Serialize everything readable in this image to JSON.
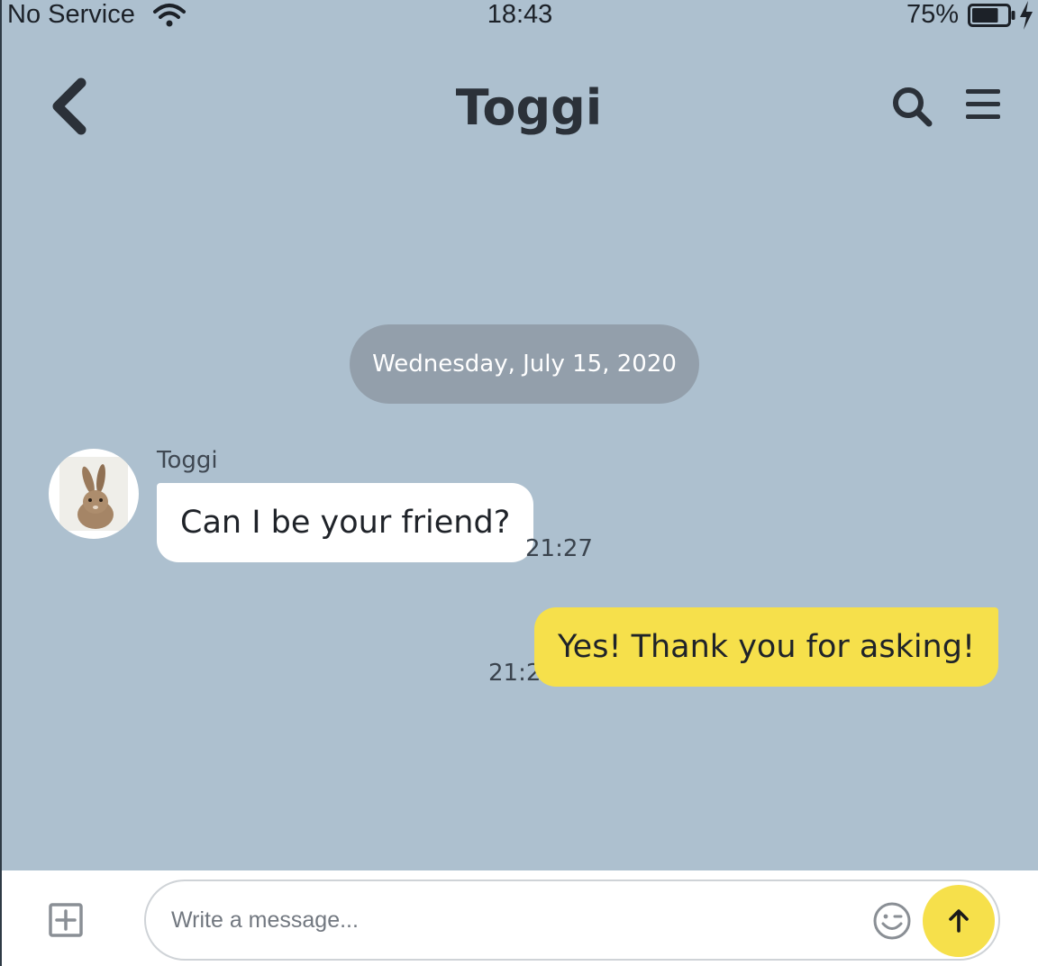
{
  "status_bar": {
    "carrier": "No Service",
    "time": "18:43",
    "battery": "75%",
    "battery_level": 0.75
  },
  "header": {
    "title": "Toggi",
    "icons": [
      "chevron-left-icon",
      "search-icon",
      "menu-icon"
    ]
  },
  "chat": {
    "date_label": "Wednesday, July 15, 2020",
    "messages": [
      {
        "direction": "incoming",
        "sender": "Toggi",
        "text": "Can I be your friend?",
        "time": "21:27"
      },
      {
        "direction": "outgoing",
        "text": "Yes! Thank you for asking!",
        "time": "21:27"
      }
    ]
  },
  "composer": {
    "placeholder": "Write a message...",
    "value": "",
    "icons": [
      "add-square-icon",
      "emoji-icon",
      "arrow-up-icon"
    ]
  },
  "colors": {
    "background": "#adc0cf",
    "outgoing_bubble": "#f6e04b",
    "incoming_bubble": "#ffffff",
    "date_pill": "#939fab",
    "send_button": "#f6e04b"
  }
}
